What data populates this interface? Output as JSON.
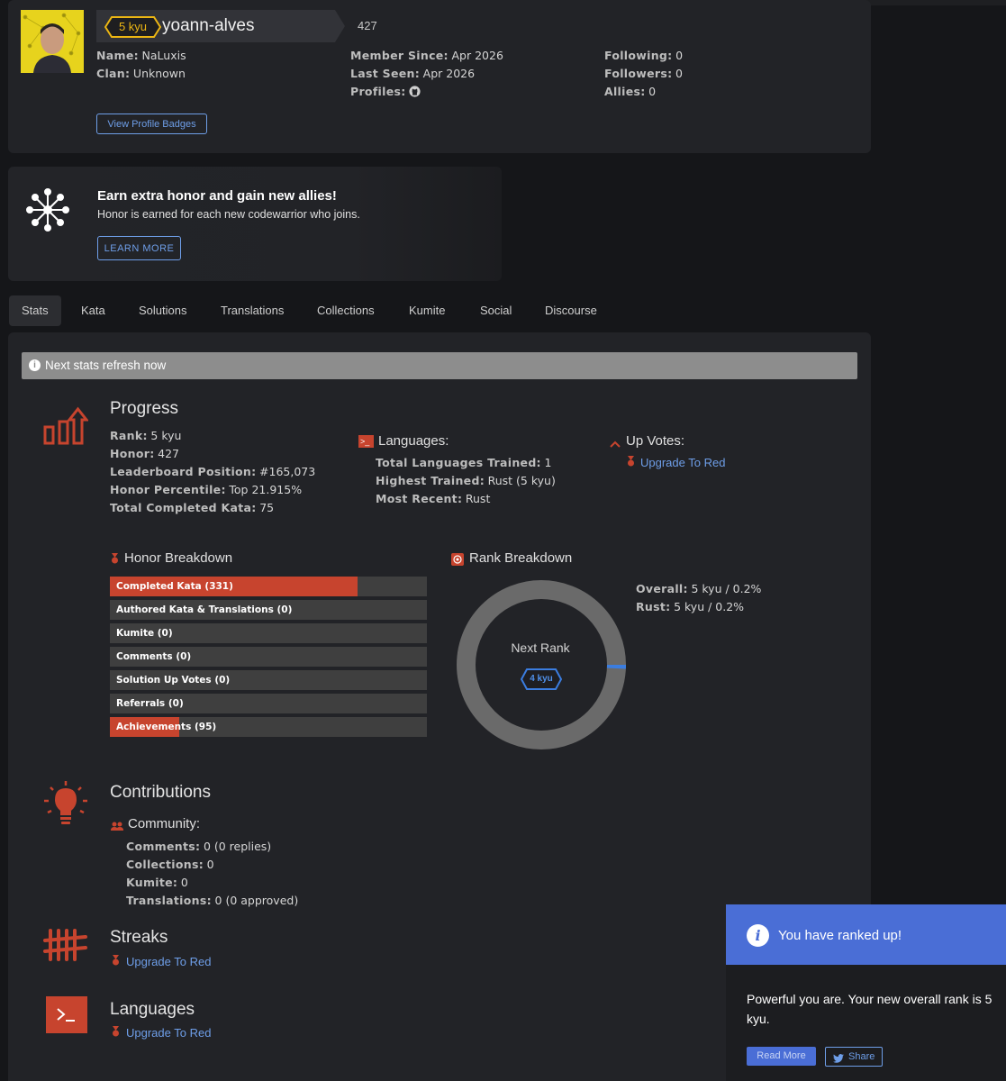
{
  "profile": {
    "rank_badge": "5 kyu",
    "username": "yoann-alves",
    "honor": "427",
    "name_label": "Name:",
    "name": "NaLuxis",
    "clan_label": "Clan:",
    "clan": "Unknown",
    "member_since_label": "Member Since:",
    "member_since": "Apr 2026",
    "last_seen_label": "Last Seen:",
    "last_seen": "Apr 2026",
    "profiles_label": "Profiles:",
    "following_label": "Following:",
    "following": "0",
    "followers_label": "Followers:",
    "followers": "0",
    "allies_label": "Allies:",
    "allies": "0",
    "badges_button": "View Profile Badges"
  },
  "promo": {
    "title": "Earn extra honor and gain new allies!",
    "text": "Honor is earned for each new codewarrior who joins.",
    "button": "LEARN MORE"
  },
  "tabs": [
    "Stats",
    "Kata",
    "Solutions",
    "Translations",
    "Collections",
    "Kumite",
    "Social",
    "Discourse"
  ],
  "notice": "Next stats refresh now",
  "progress": {
    "title": "Progress",
    "rank_label": "Rank:",
    "rank": "5 kyu",
    "honor_label": "Honor:",
    "honor": "427",
    "leaderboard_label": "Leaderboard Position:",
    "leaderboard": "#165,073",
    "percentile_label": "Honor Percentile:",
    "percentile": "Top 21.915%",
    "completed_label": "Total Completed Kata:",
    "completed": "75"
  },
  "languages": {
    "title": "Languages:",
    "trained_label": "Total Languages Trained:",
    "trained": "1",
    "highest_label": "Highest Trained:",
    "highest": "Rust (5 kyu)",
    "recent_label": "Most Recent:",
    "recent": "Rust"
  },
  "upvotes": {
    "title": "Up Votes:",
    "link": "Upgrade To Red"
  },
  "honor_breakdown": {
    "title": "Honor Breakdown",
    "items": [
      {
        "label": "Completed Kata (331)",
        "fill": 0.78
      },
      {
        "label": "Authored Kata & Translations (0)",
        "fill": 0
      },
      {
        "label": "Kumite (0)",
        "fill": 0
      },
      {
        "label": "Comments (0)",
        "fill": 0
      },
      {
        "label": "Solution Up Votes (0)",
        "fill": 0
      },
      {
        "label": "Referrals (0)",
        "fill": 0
      },
      {
        "label": "Achievements (95)",
        "fill": 0.22
      }
    ]
  },
  "rank_breakdown": {
    "title": "Rank Breakdown",
    "next_rank_label": "Next Rank",
    "next_rank": "4 kyu",
    "progress_fraction": 0.002,
    "overall_label": "Overall:",
    "overall": "5 kyu / 0.2%",
    "rust_label": "Rust:",
    "rust": "5 kyu / 0.2%"
  },
  "contributions": {
    "title": "Contributions",
    "community_label": "Community:",
    "comments_label": "Comments:",
    "comments": "0 (0 replies)",
    "collections_label": "Collections:",
    "collections": "0",
    "kumite_label": "Kumite:",
    "kumite": "0",
    "translations_label": "Translations:",
    "translations": "0 (0 approved)"
  },
  "streaks": {
    "title": "Streaks",
    "link": "Upgrade To Red"
  },
  "languages_section": {
    "title": "Languages",
    "link": "Upgrade To Red"
  },
  "toast": {
    "title": "You have ranked up!",
    "body": "Powerful you are. Your new overall rank is 5 kyu.",
    "read_more": "Read More",
    "share": "Share"
  },
  "colors": {
    "accent_red": "#c7442e",
    "link_blue": "#6e9ee8",
    "rank_yellow": "#ecb613",
    "toast_blue": "#4a6ed6"
  }
}
